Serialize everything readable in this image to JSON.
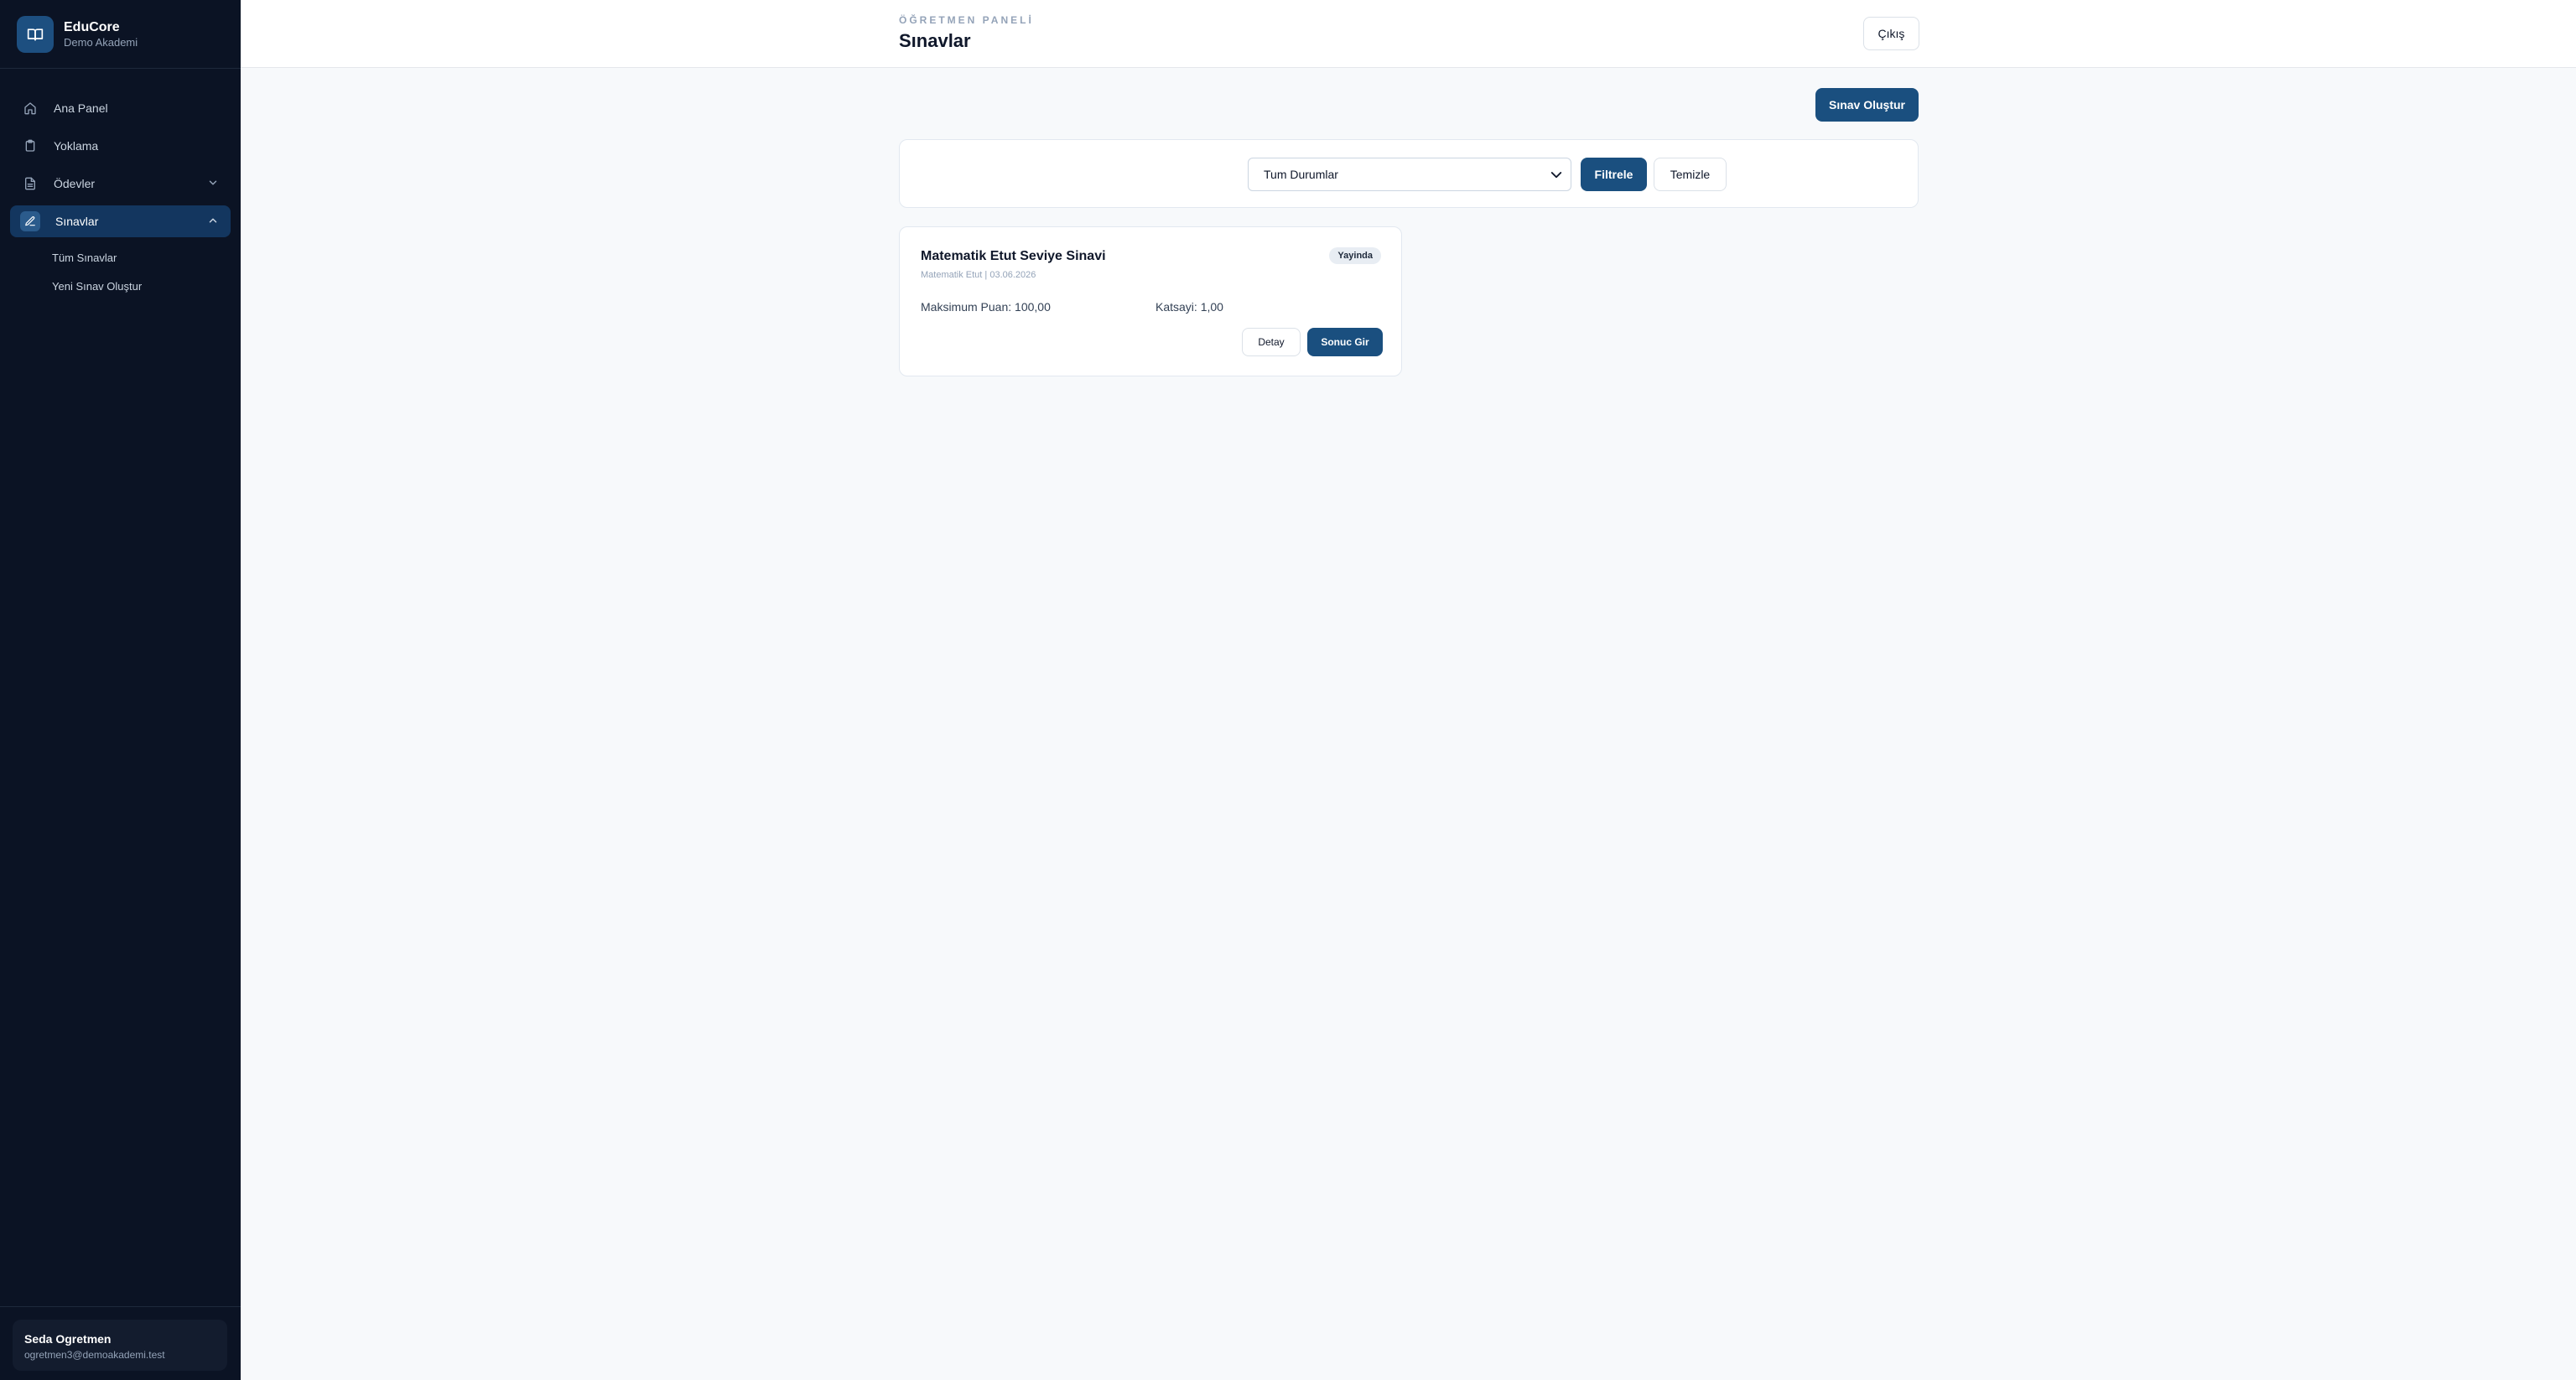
{
  "brand": {
    "name": "EduCore",
    "subtitle": "Demo Akademi",
    "logo_icon": "book-open-icon"
  },
  "sidebar": {
    "items": [
      {
        "label": "Ana Panel",
        "icon": "home-icon"
      },
      {
        "label": "Yoklama",
        "icon": "clipboard-icon"
      },
      {
        "label": "Ödevler",
        "icon": "document-icon",
        "expandable": true
      },
      {
        "label": "Sınavlar",
        "icon": "edit-icon",
        "expandable": true,
        "active": true
      }
    ],
    "sub_items": [
      "Tüm Sınavlar",
      "Yeni Sınav Oluştur"
    ]
  },
  "user": {
    "name": "Seda Ogretmen",
    "email": "ogretmen3@demoakademi.test"
  },
  "header": {
    "eyebrow": "ÖĞRETMEN PANELİ",
    "title": "Sınavlar",
    "logout_label": "Çıkış"
  },
  "actions": {
    "create_label": "Sınav Oluştur"
  },
  "filters": {
    "status_selected": "Tum Durumlar",
    "filter_label": "Filtrele",
    "clear_label": "Temizle"
  },
  "exams": [
    {
      "title": "Matematik Etut Seviye Sinavi",
      "meta": "Matematik Etut | 03.06.2026",
      "status": "Yayinda",
      "max_score": "Maksimum Puan: 100,00",
      "coefficient": "Katsayi: 1,00",
      "detail_label": "Detay",
      "result_label": "Sonuc Gir"
    }
  ],
  "colors": {
    "sidebar_bg": "#0b1324",
    "accent": "#1a4f7f",
    "page_bg": "#f7f9fb"
  }
}
